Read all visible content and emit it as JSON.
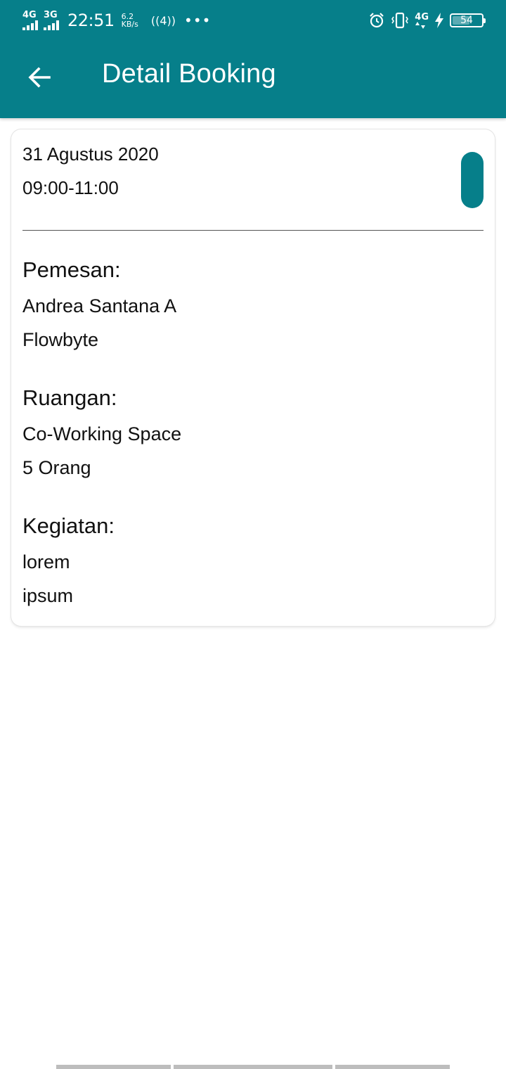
{
  "status_bar": {
    "network1": "4G",
    "network2": "3G",
    "time": "22:51",
    "speed_value": "6.2",
    "speed_unit": "KB/s",
    "hotspot_label": "4",
    "more": "•••",
    "network3": "4G",
    "battery_level": "54"
  },
  "app_bar": {
    "title": "Detail Booking",
    "back_icon": "arrow-left-icon",
    "background": "#067f8a"
  },
  "booking": {
    "date": "31 Agustus 2020",
    "time": "09:00-11:00",
    "status_color": "#067f8a",
    "sections": [
      {
        "label": "Pemesan:",
        "lines": [
          "Andrea Santana A",
          "Flowbyte"
        ]
      },
      {
        "label": "Ruangan:",
        "lines": [
          "Co-Working Space",
          "5 Orang"
        ]
      },
      {
        "label": "Kegiatan:",
        "lines": [
          "lorem",
          "ipsum"
        ]
      }
    ]
  }
}
